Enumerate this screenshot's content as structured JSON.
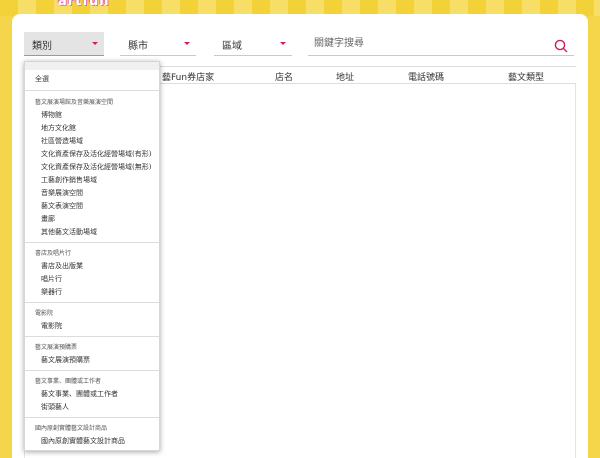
{
  "header": {
    "logo_text": "artfun"
  },
  "filters": {
    "category_label": "類別",
    "city_label": "縣市",
    "district_label": "區域",
    "search_placeholder": "關鍵字搜尋",
    "accent_color": "#d02050"
  },
  "table": {
    "columns": [
      "藝Fun券店家",
      "店名",
      "地址",
      "電話號碼",
      "藝文類型"
    ]
  },
  "dropdown": {
    "all_label": "全選",
    "groups": [
      {
        "label": "藝文展演場館及音樂展演空間",
        "items": [
          "博物館",
          "地方文化館",
          "社區營造場域",
          "文化資產保存及活化經營場域(有形)",
          "文化資產保存及活化經營場域(無形)",
          "工藝創作銷售場域",
          "音樂展演空間",
          "藝文表演空間",
          "畫廊",
          "其他藝文活動場域"
        ]
      },
      {
        "label": "書店及唱片行",
        "items": [
          "書店及出版業",
          "唱片行",
          "樂器行"
        ]
      },
      {
        "label": "電影院",
        "items": [
          "電影院"
        ]
      },
      {
        "label": "藝文展演預購票",
        "items": [
          "藝文展演預購票"
        ]
      },
      {
        "label": "藝文事業、團體或工作者",
        "items": [
          "藝文事業、團體或工作者",
          "街頭藝人"
        ]
      },
      {
        "label": "國內原創實體藝文設計商品",
        "items": [
          "國內原創實體藝文設計商品"
        ]
      }
    ]
  }
}
